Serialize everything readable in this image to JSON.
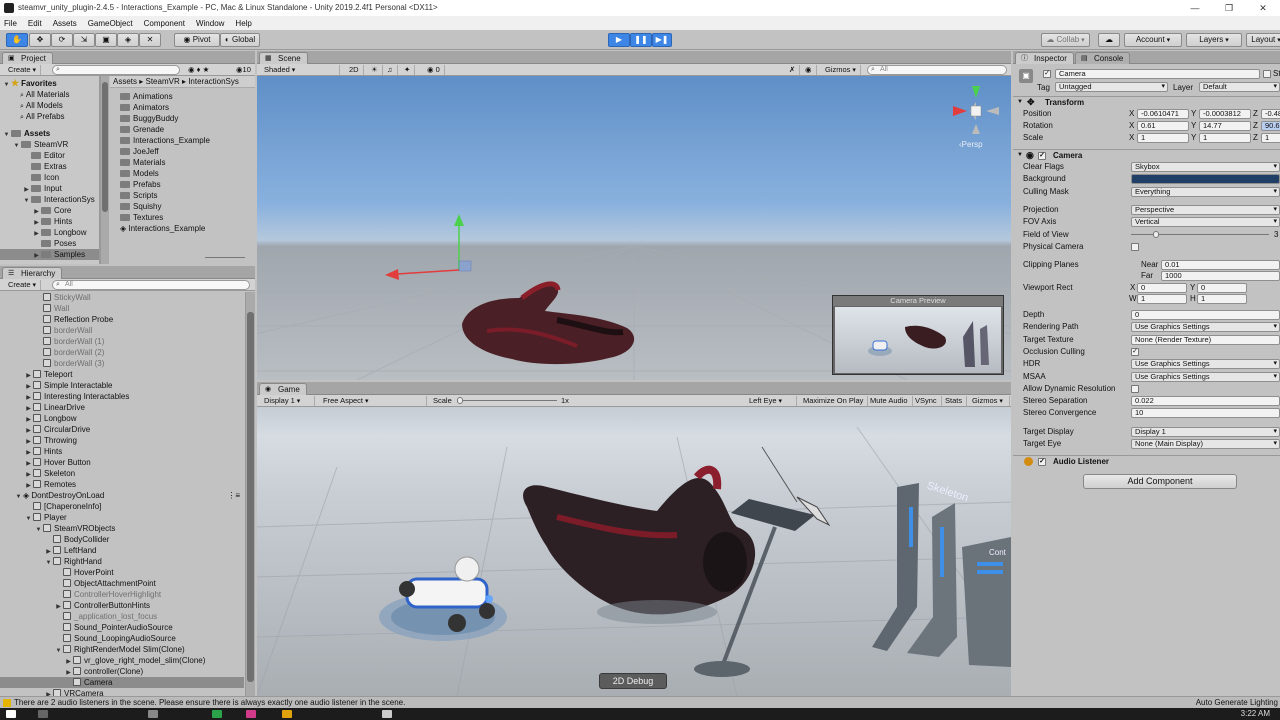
{
  "window": {
    "title": "steamvr_unity_plugin-2.4.5 - Interactions_Example - PC, Mac & Linux Standalone - Unity 2019.2.4f1 Personal <DX11>",
    "controls": [
      "—",
      "❐",
      "✕"
    ]
  },
  "menu": [
    "File",
    "Edit",
    "Assets",
    "GameObject",
    "Component",
    "Window",
    "Help"
  ],
  "toolbar": {
    "pivot_label": "Pivot",
    "global_label": "Global",
    "collab_label": "Collab",
    "account_label": "Account",
    "layers_label": "Layers",
    "layout_label": "Layout",
    "tool_icons": [
      "hand-icon",
      "move-icon",
      "rotate-icon",
      "scale-icon",
      "rect-tool-icon",
      "transform-icon",
      "custom-tool-icon"
    ],
    "play_state": "playing-paused"
  },
  "project": {
    "tab": "Project",
    "create_label": "Create",
    "count": "10",
    "favorites_title": "Favorites",
    "favorites": [
      "All Materials",
      "All Models",
      "All Prefabs"
    ],
    "assets_title": "Assets",
    "tree": [
      {
        "label": "SteamVR",
        "indent": 1,
        "fold": "open"
      },
      {
        "label": "Editor",
        "indent": 2,
        "fold": "none"
      },
      {
        "label": "Extras",
        "indent": 2,
        "fold": "none"
      },
      {
        "label": "Icon",
        "indent": 2,
        "fold": "none"
      },
      {
        "label": "Input",
        "indent": 2,
        "fold": "closed"
      },
      {
        "label": "InteractionSys",
        "indent": 2,
        "fold": "open"
      },
      {
        "label": "Core",
        "indent": 3,
        "fold": "closed"
      },
      {
        "label": "Hints",
        "indent": 3,
        "fold": "closed"
      },
      {
        "label": "Longbow",
        "indent": 3,
        "fold": "closed"
      },
      {
        "label": "Poses",
        "indent": 3,
        "fold": "none"
      },
      {
        "label": "Samples",
        "indent": 3,
        "fold": "closed",
        "selected": true
      }
    ],
    "breadcrumb": [
      "Assets",
      "SteamVR",
      "InteractionSys"
    ],
    "folder_items": [
      "Animations",
      "Animators",
      "BuggyBuddy",
      "Grenade",
      "Interactions_Example",
      "JoeJeff",
      "Materials",
      "Models",
      "Prefabs",
      "Scripts",
      "Squishy",
      "Textures"
    ],
    "scene_asset": "Interactions_Example"
  },
  "hierarchy": {
    "tab": "Hierarchy",
    "create_label": "Create",
    "search_placeholder": "All",
    "rows": [
      {
        "label": "StickyWall",
        "indent": 2,
        "fold": "none",
        "dim": true
      },
      {
        "label": "Wall",
        "indent": 2,
        "fold": "none",
        "dim": true
      },
      {
        "label": "Reflection Probe",
        "indent": 2,
        "fold": "none",
        "dim": false
      },
      {
        "label": "borderWall",
        "indent": 2,
        "fold": "none",
        "dim": true
      },
      {
        "label": "borderWall (1)",
        "indent": 2,
        "fold": "none",
        "dim": true
      },
      {
        "label": "borderWall (2)",
        "indent": 2,
        "fold": "none",
        "dim": true
      },
      {
        "label": "borderWall (3)",
        "indent": 2,
        "fold": "none",
        "dim": true
      },
      {
        "label": "Teleport",
        "indent": 1,
        "fold": "closed",
        "dim": false
      },
      {
        "label": "Simple Interactable",
        "indent": 1,
        "fold": "closed",
        "dim": false
      },
      {
        "label": "Interesting Interactables",
        "indent": 1,
        "fold": "closed",
        "dim": false
      },
      {
        "label": "LinearDrive",
        "indent": 1,
        "fold": "closed",
        "dim": false
      },
      {
        "label": "Longbow",
        "indent": 1,
        "fold": "closed",
        "dim": false
      },
      {
        "label": "CircularDrive",
        "indent": 1,
        "fold": "closed",
        "dim": false
      },
      {
        "label": "Throwing",
        "indent": 1,
        "fold": "closed",
        "dim": false
      },
      {
        "label": "Hints",
        "indent": 1,
        "fold": "closed",
        "dim": false
      },
      {
        "label": "Hover Button",
        "indent": 1,
        "fold": "closed",
        "dim": false
      },
      {
        "label": "Skeleton",
        "indent": 1,
        "fold": "closed",
        "dim": false
      },
      {
        "label": "Remotes",
        "indent": 1,
        "fold": "closed",
        "dim": false
      },
      {
        "label": "DontDestroyOnLoad",
        "indent": 0,
        "fold": "open",
        "dim": false,
        "scene": true
      },
      {
        "label": "[ChaperoneInfo]",
        "indent": 1,
        "fold": "none",
        "dim": false
      },
      {
        "label": "Player",
        "indent": 1,
        "fold": "open",
        "dim": false
      },
      {
        "label": "SteamVRObjects",
        "indent": 2,
        "fold": "open",
        "dim": false
      },
      {
        "label": "BodyCollider",
        "indent": 3,
        "fold": "none",
        "dim": false
      },
      {
        "label": "LeftHand",
        "indent": 3,
        "fold": "closed",
        "dim": false
      },
      {
        "label": "RightHand",
        "indent": 3,
        "fold": "open",
        "dim": false
      },
      {
        "label": "HoverPoint",
        "indent": 4,
        "fold": "none",
        "dim": false
      },
      {
        "label": "ObjectAttachmentPoint",
        "indent": 4,
        "fold": "none",
        "dim": false
      },
      {
        "label": "ControllerHoverHighlight",
        "indent": 4,
        "fold": "none",
        "dim": true
      },
      {
        "label": "ControllerButtonHints",
        "indent": 4,
        "fold": "closed",
        "dim": false
      },
      {
        "label": "_application_lost_focus",
        "indent": 4,
        "fold": "none",
        "dim": true
      },
      {
        "label": "Sound_PointerAudioSource",
        "indent": 4,
        "fold": "none",
        "dim": false
      },
      {
        "label": "Sound_LoopingAudioSource",
        "indent": 4,
        "fold": "none",
        "dim": false
      },
      {
        "label": "RightRenderModel Slim(Clone)",
        "indent": 4,
        "fold": "open",
        "dim": false
      },
      {
        "label": "vr_glove_right_model_slim(Clone)",
        "indent": 5,
        "fold": "closed",
        "dim": false
      },
      {
        "label": "controller(Clone)",
        "indent": 5,
        "fold": "closed",
        "dim": false
      },
      {
        "label": "Camera",
        "indent": 5,
        "fold": "none",
        "dim": false,
        "selected": true
      },
      {
        "label": "VRCamera",
        "indent": 3,
        "fold": "closed",
        "dim": false
      }
    ]
  },
  "scene": {
    "tab": "Scene",
    "shading": "Shaded",
    "mode_2d": "2D",
    "fx_count": "0",
    "gizmos_label": "Gizmos",
    "search_placeholder": "All",
    "persp_label": "‹Persp",
    "camera_preview_title": "Camera Preview"
  },
  "game": {
    "tab": "Game",
    "display": "Display 1",
    "aspect": "Free Aspect",
    "scale_label": "Scale",
    "scale_value": "1x",
    "scale_fraction": 0.0,
    "eye": "Left Eye",
    "buttons": [
      "Maximize On Play",
      "Mute Audio",
      "VSync",
      "Stats",
      "Gizmos"
    ],
    "debug_button": "2D Debug",
    "world_sign_1": "Skeleton",
    "world_sign_2": "Cont"
  },
  "inspector": {
    "tab": "Inspector",
    "console_tab": "Console",
    "object_name": "Camera",
    "static_label": "St",
    "tag_label": "Tag",
    "tag_value": "Untagged",
    "layer_label": "Layer",
    "layer_value": "Default",
    "transform": {
      "title": "Transform",
      "position_label": "Position",
      "rotation_label": "Rotation",
      "scale_label": "Scale",
      "position": [
        "-0.0610471",
        "-0.0003812",
        "-0.48"
      ],
      "rotation": [
        "0.61",
        "14.77",
        "90.66"
      ],
      "scale": [
        "1",
        "1",
        "1"
      ]
    },
    "camera": {
      "title": "Camera",
      "rows": [
        {
          "label": "Clear Flags",
          "value": "Skybox",
          "kind": "dropdown"
        },
        {
          "label": "Background",
          "value": "",
          "kind": "color"
        },
        {
          "label": "Culling Mask",
          "value": "Everything",
          "kind": "dropdown"
        },
        {
          "label": "Projection",
          "value": "Perspective",
          "kind": "dropdown",
          "gap": true
        },
        {
          "label": "FOV Axis",
          "value": "Vertical",
          "kind": "dropdown"
        },
        {
          "label": "Field of View",
          "value": "3",
          "kind": "slider"
        },
        {
          "label": "Physical Camera",
          "value": "",
          "kind": "check-off"
        }
      ],
      "clipping_label": "Clipping Planes",
      "near_label": "Near",
      "near_value": "0.01",
      "far_label": "Far",
      "far_value": "1000",
      "viewport_label": "Viewport Rect",
      "viewport": {
        "x": "0",
        "y": "0",
        "w": "1",
        "h": "1"
      },
      "rows2": [
        {
          "label": "Depth",
          "value": "0",
          "kind": "text"
        },
        {
          "label": "Rendering Path",
          "value": "Use Graphics Settings",
          "kind": "dropdown"
        },
        {
          "label": "Target Texture",
          "value": "None (Render Texture)",
          "kind": "object"
        },
        {
          "label": "Occlusion Culling",
          "value": "",
          "kind": "check-on"
        },
        {
          "label": "HDR",
          "value": "Use Graphics Settings",
          "kind": "dropdown"
        },
        {
          "label": "MSAA",
          "value": "Use Graphics Settings",
          "kind": "dropdown"
        },
        {
          "label": "Allow Dynamic Resolution",
          "value": "",
          "kind": "check-off"
        },
        {
          "label": "Stereo Separation",
          "value": "0.022",
          "kind": "text"
        },
        {
          "label": "Stereo Convergence",
          "value": "10",
          "kind": "text"
        },
        {
          "label": "Target Display",
          "value": "Display 1",
          "kind": "dropdown",
          "gap": true
        },
        {
          "label": "Target Eye",
          "value": "None (Main Display)",
          "kind": "dropdown"
        }
      ]
    },
    "audio_listener": "Audio Listener",
    "add_component": "Add Component",
    "background_color": "#1f3f66"
  },
  "status": {
    "message": "There are 2 audio listeners in the scene. Please ensure there is always exactly one audio listener in the scene.",
    "right": "Auto Generate Lighting"
  },
  "taskbar": {
    "time": "3:22 AM"
  },
  "colors": {
    "accent": "#3d86e6",
    "selection": "#8c8c8c",
    "panel": "#c2c2c2"
  }
}
